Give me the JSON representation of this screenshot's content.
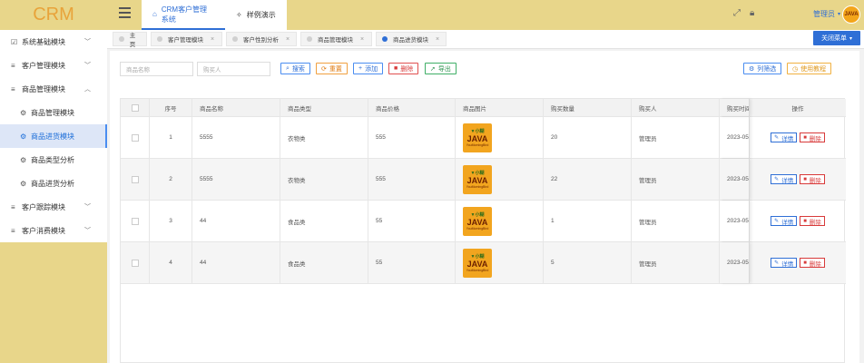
{
  "app": {
    "logo": "CRM"
  },
  "sidebar": {
    "items": [
      {
        "label": "系统基础模块",
        "icon": "checkbox-icon",
        "chev": "⌄"
      },
      {
        "label": "客户管理模块",
        "icon": "list-icon",
        "chev": "⌄"
      },
      {
        "label": "商品管理模块",
        "icon": "list-icon",
        "chev": "⌃"
      },
      {
        "label": "商品管理模块",
        "icon": "gear-icon",
        "sub": true
      },
      {
        "label": "商品进货模块",
        "icon": "gear-icon",
        "sub": true,
        "active": true
      },
      {
        "label": "商品类型分析",
        "icon": "gear-icon",
        "sub": true
      },
      {
        "label": "商品进货分析",
        "icon": "gear-icon",
        "sub": true
      },
      {
        "label": "客户跟踪模块",
        "icon": "list-icon",
        "chev": "⌄"
      },
      {
        "label": "客户消费模块",
        "icon": "list-icon",
        "chev": "⌄"
      }
    ]
  },
  "header": {
    "tab1": "CRM客户管理系统",
    "tab2": "样例演示",
    "user": "管理员",
    "avatar_text": "JAVA"
  },
  "pagetabs": [
    {
      "label": "主页",
      "closable": false
    },
    {
      "label": "客户管理模块",
      "closable": true
    },
    {
      "label": "客户性别分析",
      "closable": true
    },
    {
      "label": "商品管理模块",
      "closable": true
    },
    {
      "label": "商品进货模块",
      "closable": true,
      "active": true
    }
  ],
  "close_menu": "关闭菜单",
  "toolbar": {
    "name_placeholder": "商品名称",
    "buyer_placeholder": "购买人",
    "search": "搜索",
    "reset": "重置",
    "add": "添加",
    "delete": "删除",
    "export": "导出",
    "filter": "列筛选",
    "tutorial": "使用教程"
  },
  "table": {
    "headers": [
      "",
      "序号",
      "商品名称",
      "商品类型",
      "商品价格",
      "商品图片",
      "购买数量",
      "购买人",
      "购买时间",
      "操作"
    ],
    "rows": [
      {
        "no": "1",
        "name": "5555",
        "type": "衣物类",
        "price": "555",
        "qty": "20",
        "buyer": "管理员",
        "time": "2023-05-"
      },
      {
        "no": "2",
        "name": "5555",
        "type": "衣物类",
        "price": "555",
        "qty": "22",
        "buyer": "管理员",
        "time": "2023-05-"
      },
      {
        "no": "3",
        "name": "44",
        "type": "食品类",
        "price": "55",
        "qty": "1",
        "buyer": "管理员",
        "time": "2023-05-"
      },
      {
        "no": "4",
        "name": "44",
        "type": "食品类",
        "price": "55",
        "qty": "5",
        "buyer": "管理员",
        "time": "2023-05-"
      }
    ],
    "image_text": {
      "top": "▼小糊",
      "main": "JAVA",
      "bottom": "YouMomingBird"
    },
    "detail": "详情",
    "delete": "删除"
  }
}
